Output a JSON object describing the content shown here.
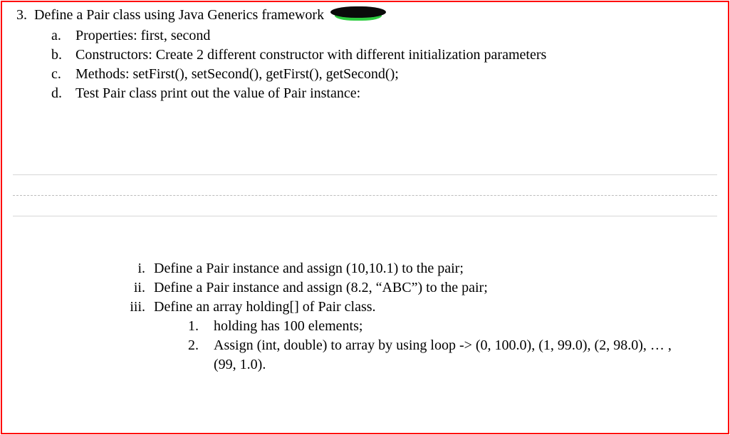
{
  "question": {
    "number": "3.",
    "text": "Define a Pair class using Java Generics framework",
    "subitems": [
      {
        "marker": "a.",
        "text": "Properties: first, second"
      },
      {
        "marker": "b.",
        "text": "Constructors: Create 2 different constructor with different initialization parameters"
      },
      {
        "marker": "c.",
        "text": "Methods: setFirst(), setSecond(), getFirst(), getSecond();"
      },
      {
        "marker": "d.",
        "text": "Test Pair class print out the value of Pair instance:"
      }
    ],
    "roman": [
      {
        "marker": "i.",
        "text": "Define a Pair instance and assign (10,10.1) to the pair;"
      },
      {
        "marker": "ii.",
        "text": "Define a Pair instance and assign (8.2, “ABC”) to the pair;"
      },
      {
        "marker": "iii.",
        "text": "Define an array holding[] of Pair class."
      }
    ],
    "nested": [
      {
        "marker": "1.",
        "text": "holding has 100 elements;"
      },
      {
        "marker": "2.",
        "text": "Assign (int, double) to array by using loop -> (0, 100.0), (1, 99.0), (2, 98.0), … , (99, 1.0)."
      }
    ]
  }
}
